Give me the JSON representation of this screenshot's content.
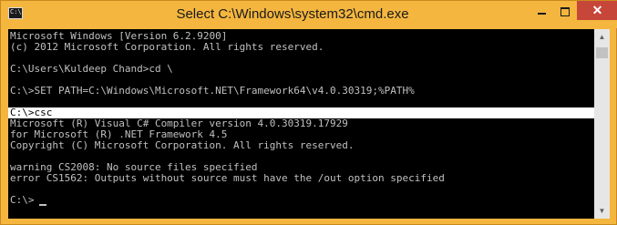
{
  "window": {
    "title": "Select C:\\Windows\\system32\\cmd.exe",
    "controls": {
      "minimize": "",
      "maximize": "",
      "close": "✕"
    }
  },
  "console": {
    "lines": [
      "Microsoft Windows [Version 6.2.9200]",
      "(c) 2012 Microsoft Corporation. All rights reserved.",
      "",
      "C:\\Users\\Kuldeep Chand>cd \\",
      "",
      "C:\\>SET PATH=C:\\Windows\\Microsoft.NET\\Framework64\\v4.0.30319;%PATH%",
      "",
      "C:\\>csc",
      "Microsoft (R) Visual C# Compiler version 4.0.30319.17929",
      "for Microsoft (R) .NET Framework 4.5",
      "Copyright (C) Microsoft Corporation. All rights reserved.",
      "",
      "warning CS2008: No source files specified",
      "error CS1562: Outputs without source must have the /out option specified",
      "",
      "C:\\>"
    ],
    "selected_line_index": 7
  },
  "scrollbar": {
    "up_arrow": "▲",
    "down_arrow": "▼"
  }
}
